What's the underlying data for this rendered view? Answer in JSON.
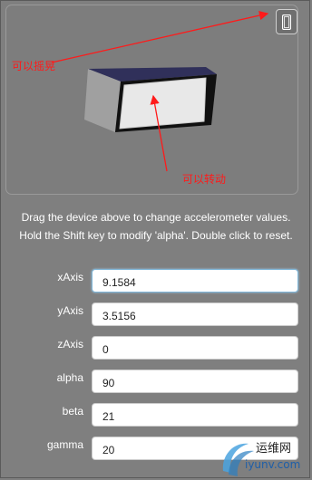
{
  "annotations": {
    "shake": "可以摇晃",
    "rotate": "可以转动"
  },
  "instructions": {
    "line1": "Drag the device above to change accelerometer values.",
    "line2": "Hold the Shift key to modify 'alpha'. Double click to reset."
  },
  "fields": [
    {
      "label": "xAxis",
      "value": "9.1584"
    },
    {
      "label": "yAxis",
      "value": "3.5156"
    },
    {
      "label": "zAxis",
      "value": "0"
    },
    {
      "label": "alpha",
      "value": "90"
    },
    {
      "label": "beta",
      "value": "21"
    },
    {
      "label": "gamma",
      "value": "20"
    }
  ],
  "icons": {
    "device_toggle": "phone-icon",
    "watermark": "swirl-logo"
  },
  "colors": {
    "background": "#7f7f7f",
    "annotation": "#ff1a1a",
    "text": "#ffffff"
  },
  "watermark": {
    "brand_cn": "运维网",
    "domain": "iyunv.com"
  }
}
